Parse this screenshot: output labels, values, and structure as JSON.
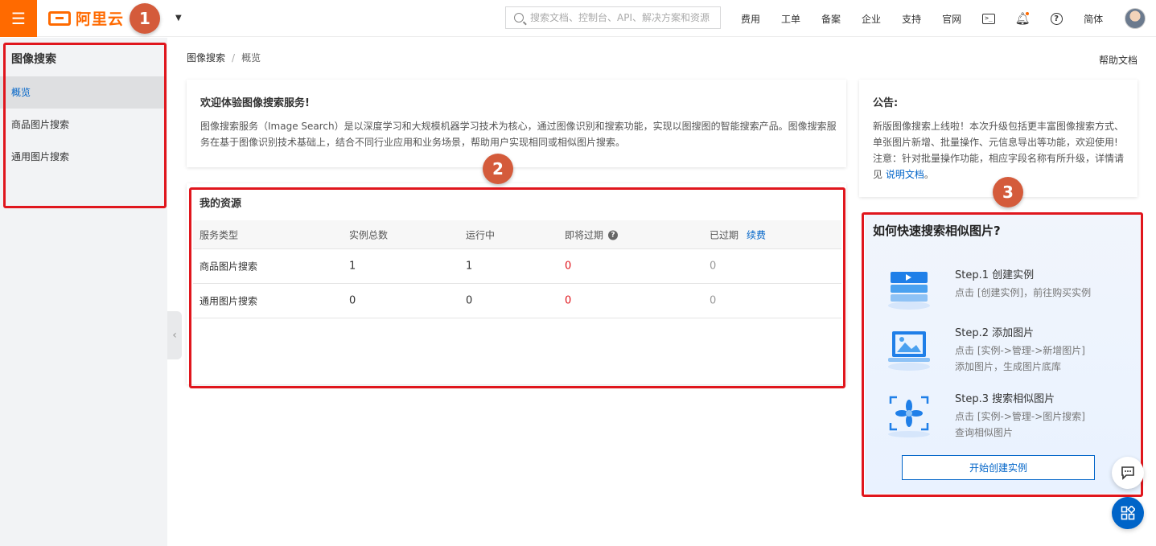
{
  "topbar": {
    "menu_icon": "hamburger-icon",
    "logo_text": "阿里云",
    "search_placeholder": "搜索文档、控制台、API、解决方案和资源",
    "nav": [
      "费用",
      "工单",
      "备案",
      "企业",
      "支持",
      "官网"
    ],
    "lang": "简体",
    "icons": [
      "terminal-icon",
      "bell-icon",
      "help-icon"
    ]
  },
  "annotations": [
    "1",
    "2",
    "3"
  ],
  "sidebar": {
    "title": "图像搜索",
    "items": [
      {
        "label": "概览",
        "active": true
      },
      {
        "label": "商品图片搜索",
        "active": false
      },
      {
        "label": "通用图片搜索",
        "active": false
      }
    ]
  },
  "breadcrumb": {
    "root": "图像搜索",
    "sep": "/",
    "current": "概览"
  },
  "help_doc": "帮助文档",
  "welcome": {
    "title": "欢迎体验图像搜索服务!",
    "line1": "图像搜索服务（Image Search）是以深度学习和大规模机器学习技术为核心，通过图像识别和搜索功能，实现以图搜图的智能搜索产品。图像搜索服",
    "line2": "务在基于图像识别技术基础上，结合不同行业应用和业务场景，帮助用户实现相同或相似图片搜索。"
  },
  "notice": {
    "title": "公告:",
    "line1": "新版图像搜索上线啦！本次升级包括更丰富图像搜索方式、",
    "line2": "单张图片新增、批量操作、元信息导出等功能，欢迎使用!",
    "line3": "注意：针对批量操作功能，相应字段名称有所升级，详情请",
    "line4_prefix": "见 ",
    "line4_link": "说明文档",
    "line4_suffix": "。"
  },
  "resources": {
    "title": "我的资源",
    "headers": {
      "type": "服务类型",
      "total": "实例总数",
      "running": "运行中",
      "expiring": "即将过期",
      "expired": "已过期",
      "renew": "续费"
    },
    "rows": [
      {
        "type": "商品图片搜索",
        "total": "1",
        "running": "1",
        "expiring": "0",
        "expired": "0"
      },
      {
        "type": "通用图片搜索",
        "total": "0",
        "running": "0",
        "expiring": "0",
        "expired": "0"
      }
    ]
  },
  "quick": {
    "title": "如何快速搜索相似图片?",
    "steps": [
      {
        "title": "Step.1 创建实例",
        "desc1": "点击 [创建实例]，前往购买实例",
        "desc2": ""
      },
      {
        "title": "Step.2 添加图片",
        "desc1": "点击 [实例->管理->新增图片]",
        "desc2": "添加图片，生成图片底库"
      },
      {
        "title": "Step.3 搜索相似图片",
        "desc1": "点击 [实例->管理->图片搜索]",
        "desc2": "查询相似图片"
      }
    ],
    "button": "开始创建实例"
  },
  "colors": {
    "brand": "#ff6a00",
    "link": "#0064c8",
    "highlight_box": "#e0161d",
    "annotation": "#d45b3b"
  }
}
